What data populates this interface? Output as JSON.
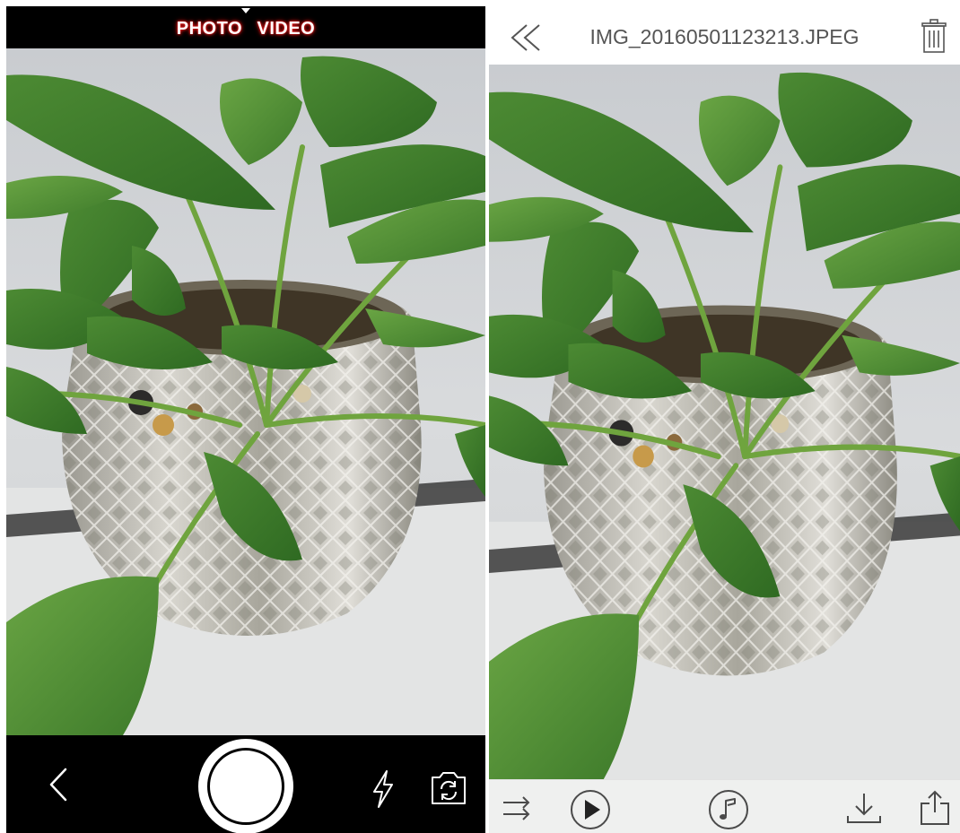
{
  "camera": {
    "modes": [
      {
        "label": "PHOTO",
        "active": true
      },
      {
        "label": "VIDEO",
        "active": false
      }
    ],
    "icons": {
      "mode_indicator": "caret-down-icon",
      "back": "chevron-left-icon",
      "shutter": "shutter-button",
      "flash": "flash-icon",
      "switch_camera": "switch-camera-icon"
    },
    "preview": "potted plant in cut-glass bowl, live viewfinder"
  },
  "viewer": {
    "title": "IMG_20160501123213.JPEG",
    "icons": {
      "back": "double-chevron-left-icon",
      "delete": "trash-icon",
      "swap": "swap-arrows-icon",
      "play": "play-circle-icon",
      "music": "music-note-circle-icon",
      "download": "download-icon",
      "share": "share-icon"
    }
  },
  "colors": {
    "mode_glow": "#d40000",
    "bar_dark": "#000000",
    "toolbar_bg": "#eef0ee",
    "icon_gray": "#4a4a4a"
  }
}
